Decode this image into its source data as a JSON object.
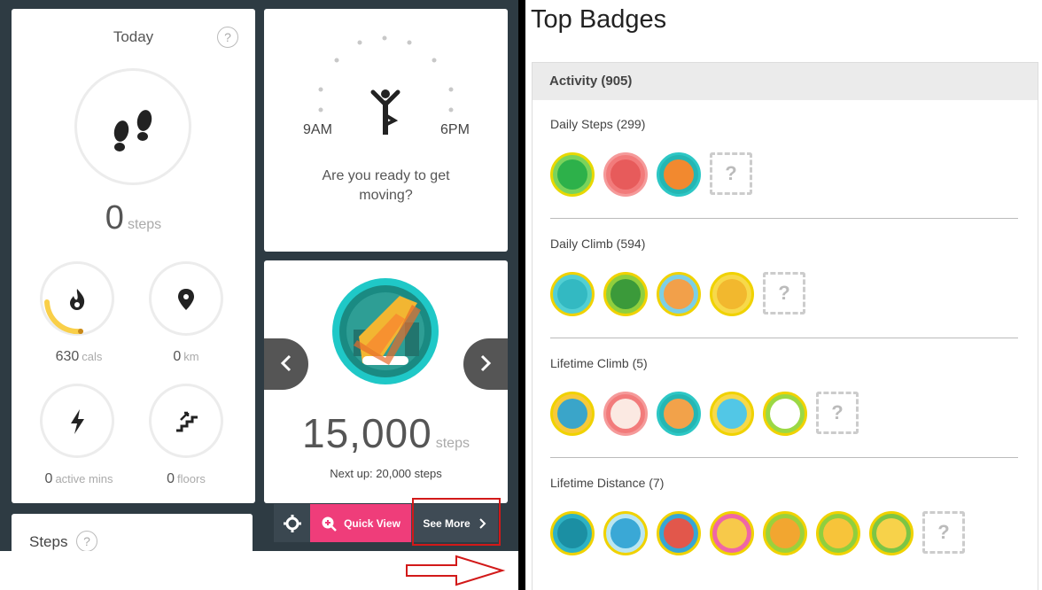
{
  "today": {
    "title": "Today",
    "help": "?",
    "steps_value": "0",
    "steps_unit": "steps",
    "calories": {
      "value": "630",
      "unit": "cals",
      "progress": 0.22
    },
    "distance": {
      "value": "0",
      "unit": "km"
    },
    "active": {
      "value": "0",
      "unit": "active mins"
    },
    "floors": {
      "value": "0",
      "unit": "floors"
    }
  },
  "hourly": {
    "start_label": "9AM",
    "end_label": "6PM",
    "message": "Are you ready to get moving?"
  },
  "badge_carousel": {
    "value": "15,000",
    "unit": "steps",
    "next_up": "Next up: 20,000 steps"
  },
  "steps_card": {
    "title": "Steps",
    "help": "?"
  },
  "actions": {
    "quick_view": "Quick View",
    "see_more": "See More"
  },
  "top_badges": {
    "title": "Top Badges",
    "activity_header": "Activity (905)",
    "sections": [
      {
        "title": "Daily Steps (299)"
      },
      {
        "title": "Daily Climb (594)"
      },
      {
        "title": "Lifetime Climb (5)"
      },
      {
        "title": "Lifetime Distance (7)"
      }
    ],
    "missing_glyph": "?"
  },
  "colors": {
    "dashboard_bg": "#2e3b43",
    "calories_arc": "#f9cf49",
    "quick_view": "#ef3d7a",
    "see_more": "#3f4b55",
    "badge_teal": "#1fc8c7",
    "highlight": "#d21919"
  }
}
